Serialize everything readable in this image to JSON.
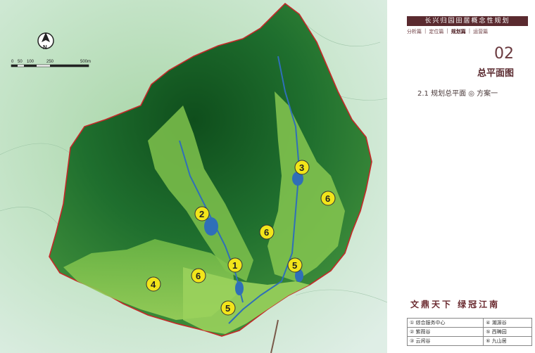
{
  "header": {
    "project_title": "长兴归园田居概念性规划",
    "nav": [
      "分析篇",
      "定位篇",
      "规划篇",
      "运营篇"
    ],
    "nav_active": "规划篇"
  },
  "section": {
    "number": "02",
    "title": "总平面图",
    "subtitle": "2.1  规划总平面 ◎ 方案一"
  },
  "slogan": "文鼎天下  绿冠江南",
  "map": {
    "north_label": "N",
    "scale_labels": [
      "0",
      "50",
      "100",
      "250",
      "500m"
    ],
    "markers": [
      "1",
      "2",
      "3",
      "4",
      "5",
      "5",
      "6",
      "6",
      "6"
    ]
  },
  "legend": [
    {
      "left": "① 综合服务中心",
      "right": "④ 潮源谷"
    },
    {
      "left": "② 紫薇谷",
      "right": "⑤ 西畴园"
    },
    {
      "left": "③ 云闲谷",
      "right": "⑥ 九山居"
    }
  ],
  "colors": {
    "title_bar": "#5a2a2f",
    "marker_fill": "#f2e51a",
    "forest_dark": "#1e6a2c",
    "forest_light": "#8cc84a",
    "water": "#2f6fb8",
    "boundary": "#c62828"
  }
}
